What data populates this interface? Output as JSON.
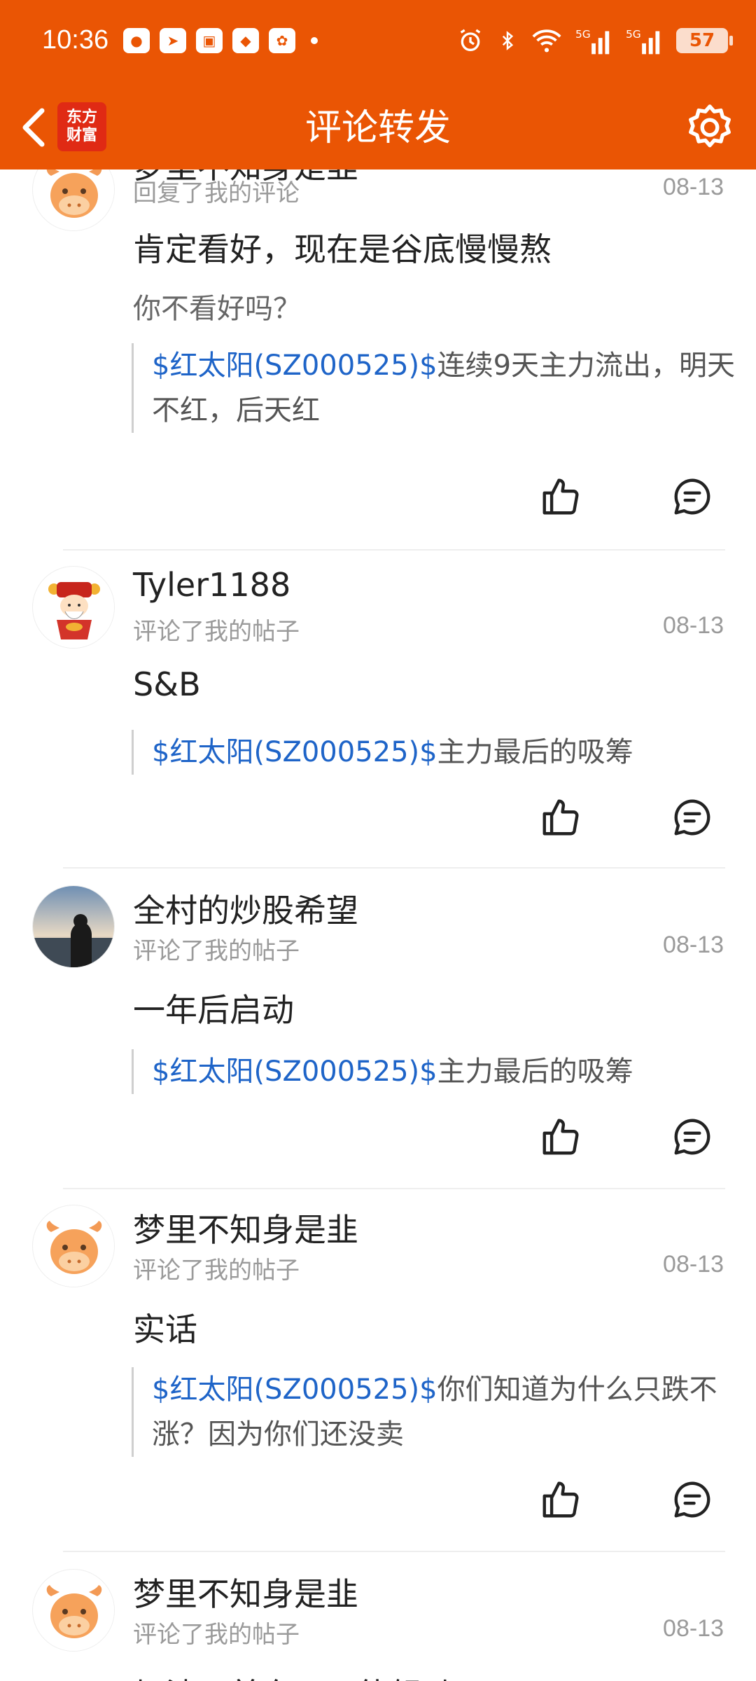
{
  "status_bar": {
    "time": "10:36",
    "battery": "57"
  },
  "nav": {
    "logo_line1": "东方",
    "logo_line2": "财富",
    "title": "评论转发"
  },
  "colors": {
    "brand": "#ea5504",
    "stock_link": "#1e64c8"
  },
  "feed": [
    {
      "name": "梦里不知身是韭",
      "action": "回复了我的评论",
      "date": "08-13",
      "comment": "肯定看好，现在是谷底慢慢熬",
      "subcomment": "你不看好吗？",
      "quote_stock": "$红太阳(SZ000525)$",
      "quote_text": "连续9天主力流出，明天不红，后天红",
      "avatar": "cow-avatar"
    },
    {
      "name": "Tyler1188",
      "action": "评论了我的帖子",
      "date": "08-13",
      "comment": "S&B",
      "quote_stock": "$红太阳(SZ000525)$",
      "quote_text": "主力最后的吸筹",
      "avatar": "fortune-god-avatar"
    },
    {
      "name": "全村的炒股希望",
      "action": "评论了我的帖子",
      "date": "08-13",
      "comment": "一年后启动",
      "quote_stock": "$红太阳(SZ000525)$",
      "quote_text": "主力最后的吸筹",
      "avatar": "beach-photo-avatar"
    },
    {
      "name": "梦里不知身是韭",
      "action": "评论了我的帖子",
      "date": "08-13",
      "comment": "实话",
      "quote_stock": "$红太阳(SZ000525)$",
      "quote_text": "你们知道为什么只跌不涨？因为你们还没卖",
      "avatar": "cow-avatar"
    },
    {
      "name": "梦里不知身是韭",
      "action": "评论了我的帖子",
      "date": "08-13",
      "comment": "加油，美东，不能轻动",
      "avatar": "cow-avatar"
    }
  ]
}
